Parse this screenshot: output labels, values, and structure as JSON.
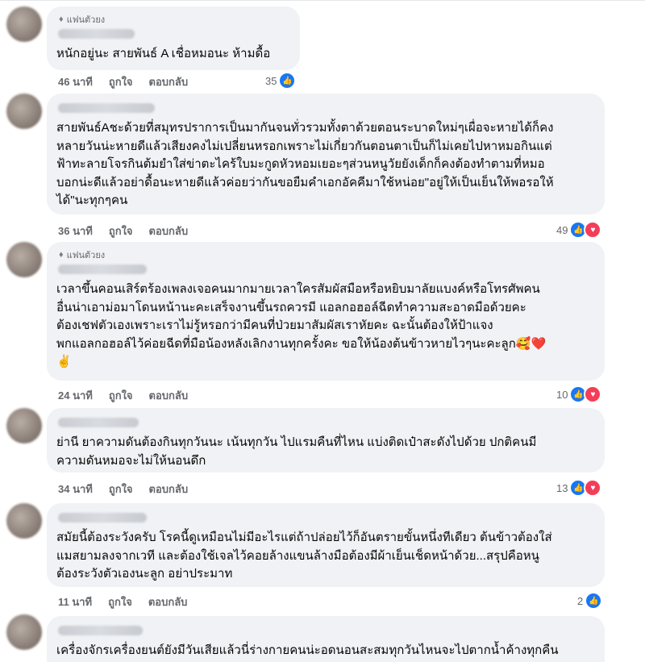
{
  "labels": {
    "like": "ถูกใจ",
    "reply": "ตอบกลับ",
    "fan_badge": "แฟนตัวยง"
  },
  "colors": {
    "like": "#1877f2",
    "love": "#f33e58",
    "bubble": "#f0f2f5",
    "meta": "#65676b"
  },
  "icons": {
    "fan_badge": "diamond-icon",
    "like": "thumbs-up-icon",
    "love": "heart-icon"
  },
  "comments": [
    {
      "fan": true,
      "lines": [
        "หนักอยู่นะ สายพันธ์ A เชื่อหมอนะ ห้ามดื้อ"
      ],
      "time": "46 นาที",
      "count": "35",
      "reactions": [
        "like"
      ]
    },
    {
      "fan": false,
      "lines": [
        "สายพันธ์Aชะด้วยที่สมุทรปราการเป็นมากันจนทั่วรวมทั้งตาด้วยตอนระบาดใหม่ๆเผื่อจะหายได้ก็คง",
        "หลายวันน่ะหายดีแล้วเสียงคงไม่เปลี่ยนหรอกเพราะไม่เกี่ยวกันตอนตาเป็นก็ไม่เคยไปหาหมอกินแต่",
        "ฟ้าทะลายโจรกินต้มยำใส่ข่าตะไคร้ใบมะกูดหัวหอมเยอะๆส่วนหนูวัยยังเด็กก็คงต้องทำตามที่หมอ",
        "บอกน่ะดีแล้วอย่าดื้อนะหายดีแล้วค่อยว่ากันขอยืมคำเอกอัคคีมาใช้หน่อย\"อยู่ให้เป็นเย็นให้พอรอให้",
        "ได้\"นะทุกๆคน"
      ],
      "time": "36 นาที",
      "count": "49",
      "reactions": [
        "like",
        "love"
      ]
    },
    {
      "fan": true,
      "lines": [
        "เวลาขึ้นคอนเสิร์ตร้องเพลงเจอคนมากมายเวลาใครสัมผัสมือหรือหยิบมาลัยแบงค์หรือโทรศัพคน",
        "อื่นน่าเอาม่อมาโดนหน้านะคะเสร็จงานขึ้นรถควรมี แอลกอฮอล์ฉีดทำความสะอาดมือด้วยคะ",
        "ต้องเชฟตัวเองเพราะเราไม่รู้หรอกว่ามีคนที่ป่วยมาสัมผัสเราหัยคะ ฉะนั้นต้องให้ป้าแจง",
        "พกแอลกอฮอล์ไว้ค่อยฉีดที่มือน้องหลังเลิกงานทุกครั้งคะ ขอให้น้องต้นข้าวหายไวๆนะคะลูก🥰❤️",
        "✌️"
      ],
      "time": "24 นาที",
      "count": "10",
      "reactions": [
        "like",
        "love"
      ]
    },
    {
      "fan": false,
      "lines": [
        "ย่านี ยาความดันต้องกินทุกวันนะ เน้นทุกวัน ไปแรมคืนที่ไหน แบ่งติดเป๋าสะดังไปด้วย ปกติคนมี",
        "ความดันหมอจะไม่ให้นอนดึก"
      ],
      "time": "34 นาที",
      "count": "13",
      "reactions": [
        "like",
        "love"
      ]
    },
    {
      "fan": false,
      "lines": [
        "สมัยนี้ต้องระวังครับ โรคนี้ดูเหมือนไม่มีอะไรแต่ถ้าปล่อยไว้ก็อันตรายขั้นหนึ่งทีเดียว ต้นข้าวต้องใส่",
        "แมสยามลงจากเวที และต้องใช้เจลไว้คอยล้างแขนล้างมือต้องมีผ้าเย็นเช็ดหน้าด้วย...สรุปคือหนู",
        "ต้องระวังตัวเองนะลูก อย่าประมาท"
      ],
      "time": "11 นาที",
      "count": "2",
      "reactions": [
        "like"
      ]
    },
    {
      "fan": false,
      "lines": [
        "เครื่องจักรเครื่องยนต์ยังมีวันเสียแล้วนี่ร่างกายคนน่ะอดนอนสะสมทุกวันไหนจะไปตากน้ำค้างทุกคืน"
      ]
    }
  ]
}
